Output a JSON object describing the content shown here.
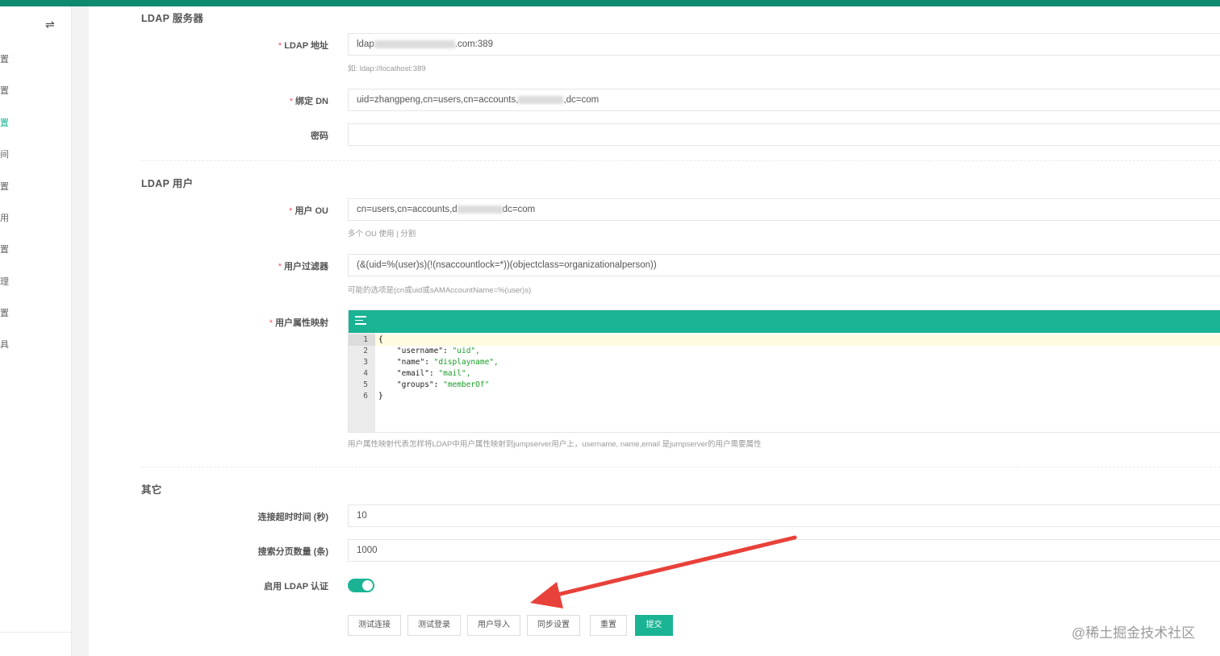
{
  "sidebar": {
    "toggle_icon": "⇌",
    "items": [
      "置",
      "置",
      "置",
      "间",
      "置",
      "用",
      "置",
      "理",
      "置",
      "具"
    ],
    "active_index": 2
  },
  "sections": {
    "ldap_server": "LDAP 服务器",
    "ldap_user": "LDAP 用户",
    "other": "其它"
  },
  "fields": {
    "ldap_address": {
      "label": "LDAP 地址",
      "value_prefix": "ldap",
      "value_suffix": ".com:389",
      "help": "如: ldap://localhost:389"
    },
    "bind_dn": {
      "label": "绑定 DN",
      "value_prefix": "uid=zhangpeng,cn=users,cn=accounts,",
      "value_suffix": ",dc=com"
    },
    "password": {
      "label": "密码",
      "value": ""
    },
    "user_ou": {
      "label": "用户 OU",
      "value_prefix": "cn=users,cn=accounts,d",
      "value_suffix": "dc=com",
      "help": "多个 OU 使用 | 分割"
    },
    "user_filter": {
      "label": "用户过滤器",
      "value": "(&(uid=%(user)s)(!(nsaccountlock=*))(objectclass=organizationalperson))",
      "help": "可能的选项是(cn或uid或sAMAccountName=%(user)s)"
    },
    "attr_map": {
      "label": "用户属性映射",
      "help": "用户属性映射代表怎样将LDAP中用户属性映射到jumpserver用户上，username, name,email 是jumpserver的用户需要属性",
      "lines": [
        {
          "num": "1",
          "open": "{"
        },
        {
          "num": "2",
          "key": "\"username\"",
          "val": "\"uid\","
        },
        {
          "num": "3",
          "key": "\"name\"",
          "val": "\"displayname\","
        },
        {
          "num": "4",
          "key": "\"email\"",
          "val": "\"mail\","
        },
        {
          "num": "5",
          "key": "\"groups\"",
          "val": "\"memberOf\""
        },
        {
          "num": "6",
          "open": "}"
        }
      ]
    },
    "timeout": {
      "label": "连接超时时间 (秒)",
      "value": "10"
    },
    "page_size": {
      "label": "搜索分页数量 (条)",
      "value": "1000"
    },
    "enable_ldap": {
      "label": "启用 LDAP 认证",
      "enabled": true
    }
  },
  "required_mark": "*",
  "buttons": {
    "test_connection": "测试连接",
    "test_login": "测试登录",
    "user_import": "用户导入",
    "sync_settings": "同步设置",
    "reset": "重置",
    "submit": "提交"
  },
  "colors": {
    "accent": "#1ab394",
    "topbar": "#0e8a6f",
    "annotation_arrow": "#e8413a"
  },
  "watermark": "@稀土掘金技术社区"
}
